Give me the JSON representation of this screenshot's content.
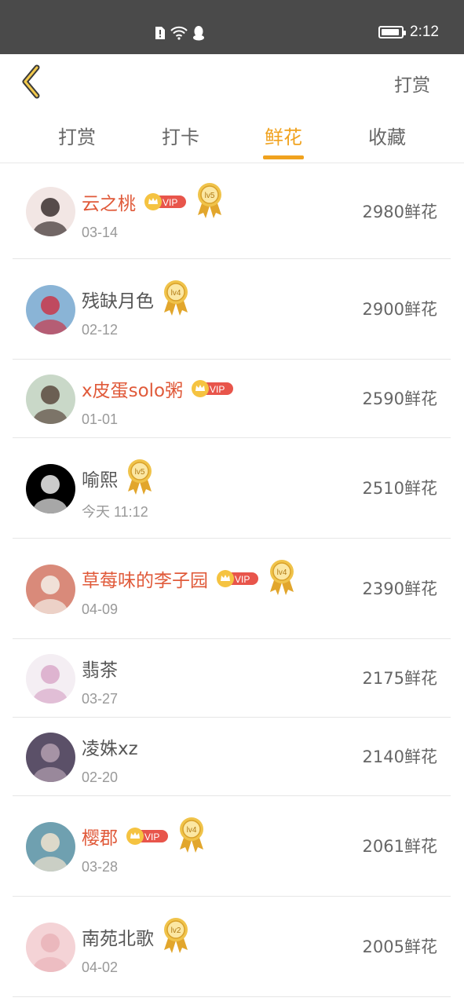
{
  "status_bar": {
    "time": "2:12",
    "battery_level": 0.9
  },
  "header": {
    "action_label": "打赏"
  },
  "tabs": [
    {
      "label": "打赏",
      "active": false
    },
    {
      "label": "打卡",
      "active": false
    },
    {
      "label": "鲜花",
      "active": true
    },
    {
      "label": "收藏",
      "active": false
    }
  ],
  "colors": {
    "accent": "#f0a21e",
    "vip_name": "#e05a3a",
    "vip_badge": "#e8554b"
  },
  "entries": [
    {
      "name": "云之桃",
      "vip": true,
      "vip_label": "VIP",
      "level": "lv5",
      "date": "03-14",
      "amount": "2980鲜花"
    },
    {
      "name": "残缺月色",
      "vip": false,
      "level": "lv4",
      "date": "02-12",
      "amount": "2900鲜花"
    },
    {
      "name": "x皮蛋solo粥",
      "vip": true,
      "vip_label": "VIP",
      "level": "",
      "date": "01-01",
      "amount": "2590鲜花"
    },
    {
      "name": "喻熙",
      "vip": false,
      "level": "lv5",
      "date": "今天 11:12",
      "amount": "2510鲜花"
    },
    {
      "name": "草莓味的李子园",
      "vip": true,
      "vip_label": "VIP",
      "level": "lv4",
      "date": "04-09",
      "amount": "2390鲜花"
    },
    {
      "name": "翡茶",
      "vip": false,
      "level": "",
      "date": "03-27",
      "amount": "2175鲜花"
    },
    {
      "name": "凌姝xz",
      "vip": false,
      "level": "",
      "date": "02-20",
      "amount": "2140鲜花"
    },
    {
      "name": "樱郡",
      "vip": true,
      "vip_label": "VIP",
      "level": "lv4",
      "date": "03-28",
      "amount": "2061鲜花"
    },
    {
      "name": "南苑北歌",
      "vip": false,
      "level": "lv2",
      "date": "04-02",
      "amount": "2005鲜花"
    }
  ]
}
